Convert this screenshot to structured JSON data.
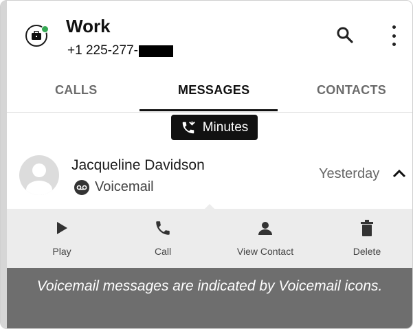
{
  "header": {
    "title": "Work",
    "phone_prefix": "+1 225-277-",
    "icons": {
      "account": "briefcase-icon",
      "status": "online-dot",
      "search": "search-icon",
      "menu": "more-vert-icon"
    }
  },
  "tabs": [
    {
      "label": "CALLS",
      "active": false
    },
    {
      "label": "MESSAGES",
      "active": true
    },
    {
      "label": "CONTACTS",
      "active": false
    }
  ],
  "badge": {
    "label": "Minutes",
    "icon": "call-missed-icon"
  },
  "message": {
    "name": "Jacqueline Davidson",
    "type_label": "Voicemail",
    "date": "Yesterday",
    "expanded": true
  },
  "actions": [
    {
      "label": "Play",
      "icon": "play-icon"
    },
    {
      "label": "Call",
      "icon": "phone-icon"
    },
    {
      "label": "View Contact",
      "icon": "person-icon"
    },
    {
      "label": "Delete",
      "icon": "trash-icon"
    }
  ],
  "caption": "Voicemail messages are indicated by Voicemail icons.",
  "colors": {
    "status_green": "#34a853",
    "caption_bg": "#6e6e6e",
    "action_bg": "#ececec"
  }
}
